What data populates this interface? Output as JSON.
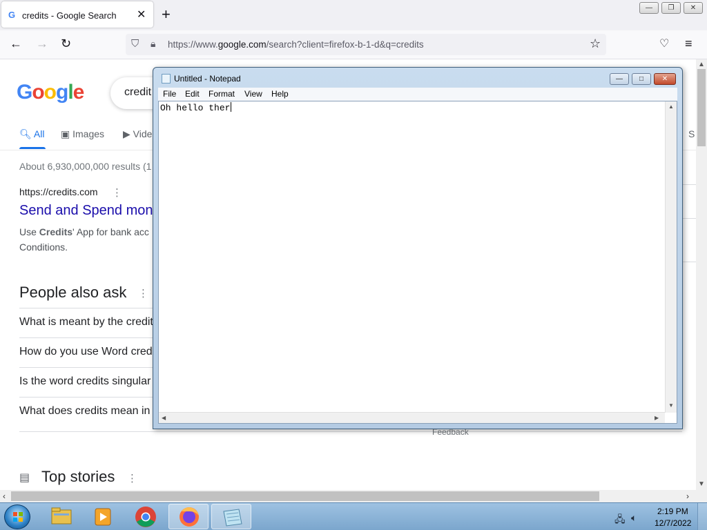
{
  "browser": {
    "tab_title": "credits - Google Search",
    "tab_favicon": "G",
    "url_prefix": "https://www.",
    "url_domain": "google.com",
    "url_path": "/search?client=firefox-b-1-d&q=credits"
  },
  "google": {
    "logo_letters": [
      "G",
      "o",
      "o",
      "g",
      "l",
      "e"
    ],
    "logo_colors": [
      "#4285f4",
      "#ea4335",
      "#fbbc05",
      "#4285f4",
      "#34a853",
      "#ea4335"
    ],
    "search_query": "credit",
    "tabs": [
      "All",
      "Images",
      "Vide",
      "S"
    ],
    "result_stats": "About 6,930,000,000 results (1",
    "result": {
      "cite": "https://credits.com",
      "title": "Send and Spend mon",
      "snippet_pre": "Use ",
      "snippet_bold": "Credits",
      "snippet_post": "' App for bank acc",
      "snippet_line2": "Conditions."
    },
    "people_also_ask": {
      "title": "People also ask",
      "questions": [
        "What is meant by the credit",
        "How do you use Word cred",
        "Is the word credits singular",
        "What does credits mean in"
      ]
    },
    "feedback": "Feedback",
    "top_stories": "Top stories"
  },
  "notepad": {
    "title": "Untitled - Notepad",
    "menu": [
      "File",
      "Edit",
      "Format",
      "View",
      "Help"
    ],
    "content": "Oh hello ther"
  },
  "taskbar": {
    "time": "2:19 PM",
    "date": "12/7/2022"
  },
  "icons": {
    "back": "arrow-left-icon",
    "forward": "arrow-right-icon",
    "reload": "reload-icon",
    "bookmark": "star-icon",
    "pocket": "pocket-icon",
    "menu": "hamburger-menu-icon"
  }
}
